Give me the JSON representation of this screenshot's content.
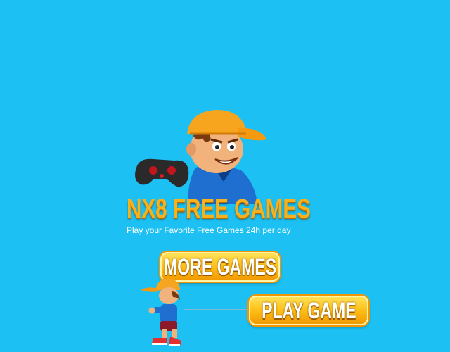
{
  "logo": {
    "title": "NX8  FREE GAMES",
    "tagline": "Play your Favorite Free Games 24h per day"
  },
  "buttons": {
    "more_games": "MORE GAMES",
    "play_game": "PLAY GAME"
  },
  "colors": {
    "background": "#1cc0f2",
    "logo_orange": "#f6b11c",
    "button_gold": "#ffc21b"
  },
  "icons": {
    "mascot": "boy-with-cap-holding-gamepad",
    "runner": "running-boy-sprite"
  }
}
